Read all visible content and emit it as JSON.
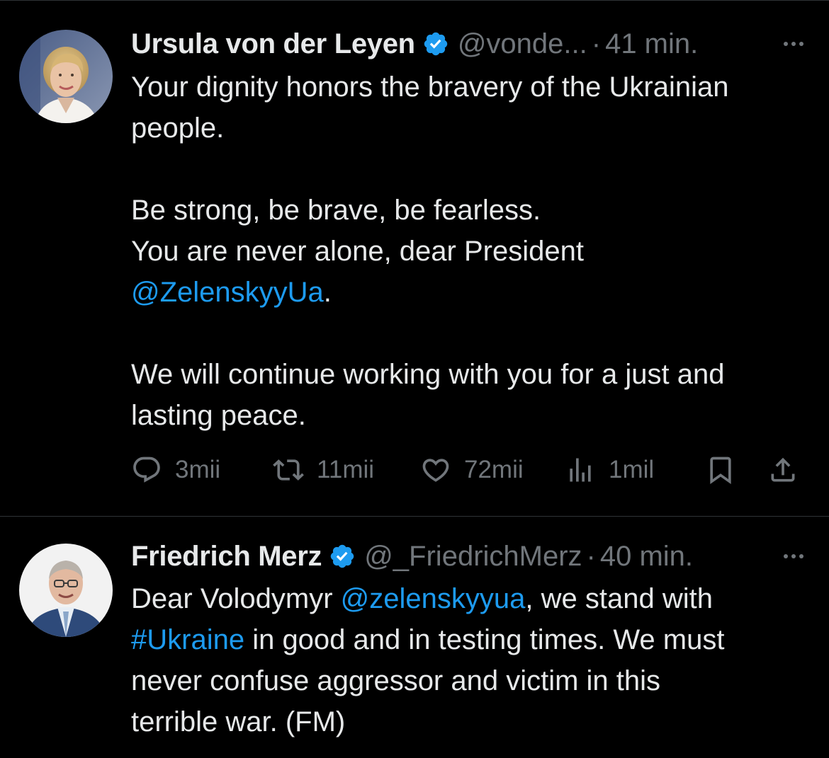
{
  "tweets": [
    {
      "author_name": "Ursula von der Leyen",
      "handle": "@vonde...",
      "separator": "·",
      "time": "41 min.",
      "lines": [
        {
          "segments": [
            {
              "text": "Your dignity honors the bravery of the Ukrainian"
            }
          ]
        },
        {
          "segments": [
            {
              "text": "people."
            }
          ]
        },
        {
          "blank": true
        },
        {
          "segments": [
            {
              "text": "Be strong, be brave, be fearless."
            }
          ]
        },
        {
          "segments": [
            {
              "text": "You are never alone, dear President"
            }
          ]
        },
        {
          "segments": [
            {
              "text": "@ZelenskyyUa",
              "link": true
            },
            {
              "text": "."
            }
          ]
        },
        {
          "blank": true
        },
        {
          "segments": [
            {
              "text": "We will continue working with you for a just and"
            }
          ]
        },
        {
          "segments": [
            {
              "text": "lasting peace."
            }
          ]
        }
      ],
      "actions": {
        "replies": "3mii",
        "reposts": "11mii",
        "likes": "72mii",
        "views": "1mil"
      }
    },
    {
      "author_name": "Friedrich Merz",
      "handle": "@_FriedrichMerz",
      "separator": "·",
      "time": "40 min.",
      "lines": [
        {
          "segments": [
            {
              "text": "Dear Volodymyr "
            },
            {
              "text": "@zelenskyyua",
              "link": true
            },
            {
              "text": ", we stand with"
            }
          ]
        },
        {
          "segments": [
            {
              "text": "#Ukraine",
              "link": true
            },
            {
              "text": " in good and in testing times. We must"
            }
          ]
        },
        {
          "segments": [
            {
              "text": "never confuse aggressor and victim in this"
            }
          ]
        },
        {
          "segments": [
            {
              "text": "terrible war. (FM)"
            }
          ]
        }
      ]
    }
  ],
  "colors": {
    "background": "#000000",
    "text": "#e7e9ea",
    "secondary": "#71767b",
    "link": "#1d9bf0",
    "verified": "#1d9bf0",
    "divider": "#2f3336"
  },
  "icons": {
    "verified": "verified-badge-icon",
    "more": "more-horizontal-icon",
    "reply": "reply-bubble-icon",
    "repost": "repost-arrows-icon",
    "like": "heart-icon",
    "views": "views-bars-icon",
    "bookmark": "bookmark-icon",
    "share": "share-upload-icon"
  }
}
